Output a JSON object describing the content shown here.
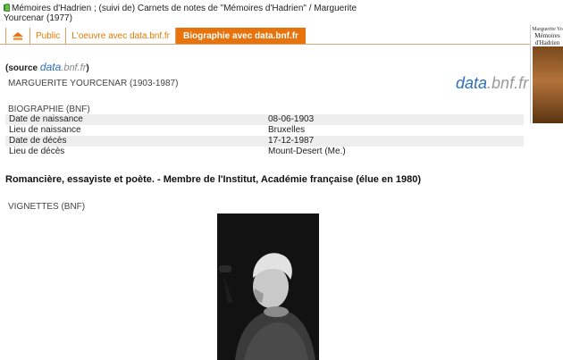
{
  "header": {
    "title_line1": "Mémoires d'Hadrien ; (suivi de) Carnets de notes de \"Mémoires d'Hadrien\" / Marguerite",
    "title_line2": "Yourcenar (1977)"
  },
  "tabs": [
    {
      "label": "",
      "icon": "catalog-icon"
    },
    {
      "label": "Public"
    },
    {
      "label": "L'oeuvre avec data.bnf.fr"
    },
    {
      "label": "Biographie avec data.bnf.fr",
      "active": true
    }
  ],
  "cover": {
    "title1": "Marguerite Yo",
    "title2": "Mémoires",
    "title3": "d'Hadrien"
  },
  "source": {
    "prefix": "(source ",
    "brand1": "data",
    "brand2": ".bnf.fr",
    "suffix": ")"
  },
  "author": "MARGUERITE YOURCENAR (1903-1987)",
  "logo": {
    "part1": "data",
    "part2": ".bnf.fr"
  },
  "biography": {
    "heading": "BIOGRAPHIE (BNF)",
    "rows": [
      {
        "label": "Date de naissance",
        "value": "08-06-1903"
      },
      {
        "label": "Lieu de naissance",
        "value": "Bruxelles"
      },
      {
        "label": "Date de décès",
        "value": "17-12-1987"
      },
      {
        "label": "Lieu de décès",
        "value": "Mount-Desert (Me.)"
      }
    ]
  },
  "summary": "Romancière, essayiste et poète. - Membre de l'Institut, Académie française (élue en 1980)",
  "vignettes_heading": "VIGNETTES (BNF)",
  "colors": {
    "accent": "#e8730c",
    "brand_blue": "#2a6ebb"
  }
}
